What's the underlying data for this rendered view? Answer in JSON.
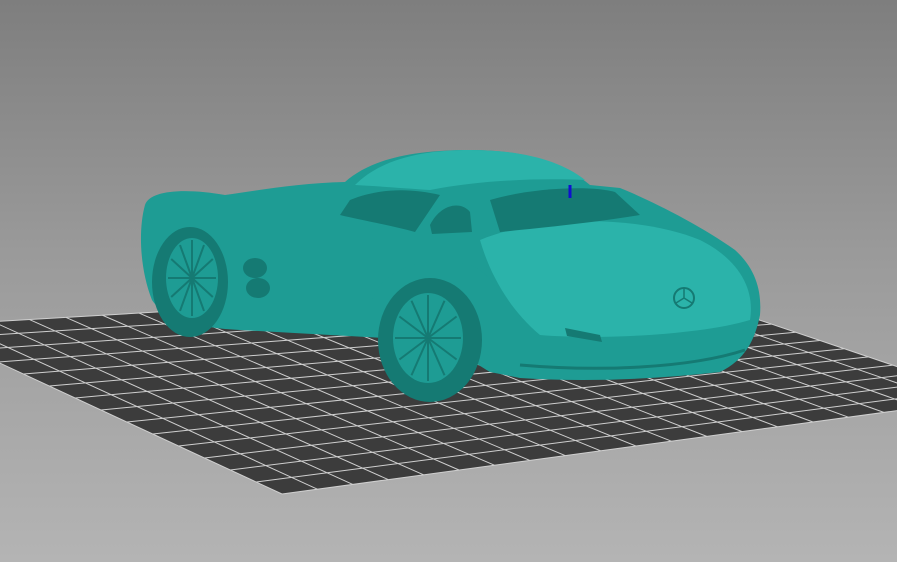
{
  "viewport": {
    "background_top": "#7e7e7e",
    "background_bottom": "#b4b4b4"
  },
  "bed": {
    "fill": "#3c3c3c",
    "grid_line": "#cfcfcf",
    "cells_u": 20,
    "cells_v": 14
  },
  "model": {
    "color": "#1e9c94",
    "shade": "#157a73",
    "highlight": "#2bb3aa"
  },
  "axis": {
    "z_color": "#1010d0"
  }
}
